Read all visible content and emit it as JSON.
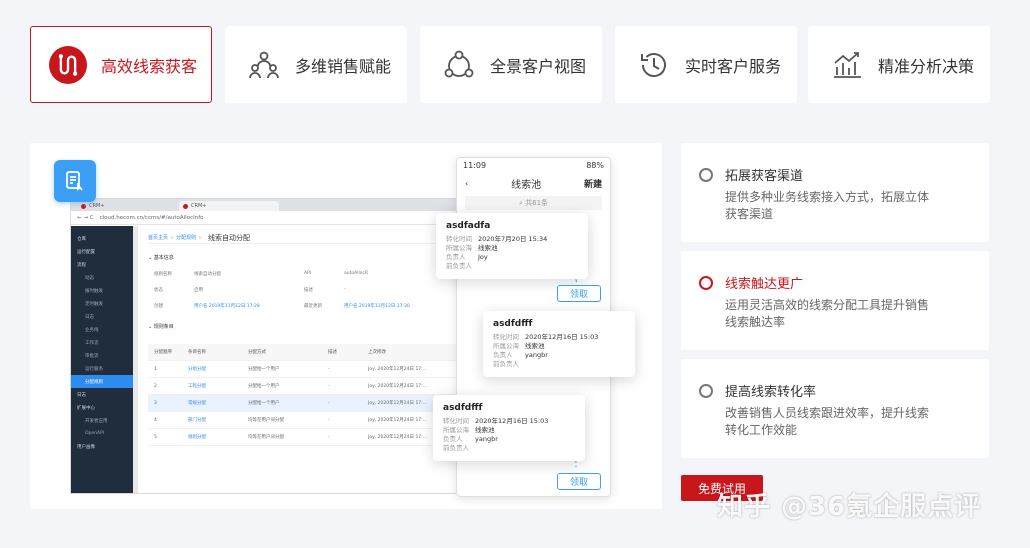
{
  "tabs": [
    {
      "label": "高效线索获客",
      "icon": "lead-loop-icon",
      "active": true
    },
    {
      "label": "多维销售赋能",
      "icon": "team-icon",
      "active": false
    },
    {
      "label": "全景客户视图",
      "icon": "network-icon",
      "active": false
    },
    {
      "label": "实时客户服务",
      "icon": "history-clock-icon",
      "active": false
    },
    {
      "label": "精准分析决策",
      "icon": "chart-trend-icon",
      "active": false
    }
  ],
  "browser": {
    "tab1": "CRM+",
    "tab2": "CRM+",
    "url": "cloud.hecom.cn/ccms/#/autoAllocInfo",
    "sidebar": [
      "仓库",
      "运行配置",
      "流程",
      "动态",
      "报时触发",
      "定时触发",
      "日志",
      "业务线",
      "工作流",
      "审批流",
      "运行服务",
      "分配规则",
      "日志",
      "扩展中心",
      "开发者应用",
      "OpenAPI",
      "用户画像"
    ],
    "breadcrumb": [
      "首页主页",
      "分配规则"
    ],
    "page_title": "线索自动分配",
    "section1": "基本信息",
    "fields": [
      [
        "规则名称",
        "线索自动分配",
        "API",
        "autoAllocR"
      ],
      [
        "状态",
        "启用",
        "描述",
        "-"
      ],
      [
        "创建",
        "用户名 2019年11月12日 17:28",
        "最近更新",
        "用户名 2019年11月12日 17:30"
      ]
    ],
    "section2": "规则条目",
    "table_head": [
      "分配顺序",
      "条目名称",
      "分配方式",
      "描述",
      "上次修改"
    ],
    "table_rows": [
      [
        "1",
        "分组分配",
        "分配给一个用户",
        "-",
        "Joy, 2020年12月24日 17:..."
      ],
      [
        "2",
        "工程分配",
        "分配给一个用户",
        "-",
        "Joy, 2020年12月24日 17:..."
      ],
      [
        "3",
        "常规分配",
        "分配给一个用户",
        "-",
        "Joy, 2020年12月24日 17:..."
      ],
      [
        "4",
        "部门分配",
        "均等在用户间分配",
        "-",
        "Joy, 2020年12月24日 17:..."
      ],
      [
        "5",
        "规则分配",
        "均等在用户间分配",
        "-",
        "Joy, 2020年12月24日 17:..."
      ]
    ]
  },
  "phone": {
    "time": "11:09",
    "battery": "88%",
    "title": "线索池",
    "new_label": "新建",
    "search": "共61条"
  },
  "lead_labels": {
    "time": "转化时间",
    "pool": "所属公海",
    "owner": "负责人",
    "prev": "前负责人"
  },
  "leads": [
    {
      "name": "asdfadfa",
      "time": "2020年7月20日 15:34",
      "pool": "线索池",
      "owner": "Joy",
      "prev": ""
    },
    {
      "name": "asdfdfff",
      "time": "2020年12月16日 15:03",
      "pool": "线索池",
      "owner": "yangbr",
      "prev": ""
    },
    {
      "name": "asdfdfff",
      "time": "2020年12月16日 15:03",
      "pool": "线索池",
      "owner": "yangbr",
      "prev": ""
    }
  ],
  "claim_label": "领取",
  "features": [
    {
      "title": "拓展获客渠道",
      "desc": "提供多种业务线索接入方式，拓展立体获客渠道",
      "active": false
    },
    {
      "title": "线索触达更广",
      "desc": "运用灵活高效的线索分配工具提升销售线索触达率",
      "active": true
    },
    {
      "title": "提高线索转化率",
      "desc": "改善销售人员线索跟进效率，提升线索转化工作效能",
      "active": false
    }
  ],
  "trial_button": "免费试用",
  "watermark": "知乎 @36氪企服点评",
  "colors": {
    "brand": "#c8161d",
    "accent": "#3b9ff5",
    "bg": "#f4f5f9"
  }
}
